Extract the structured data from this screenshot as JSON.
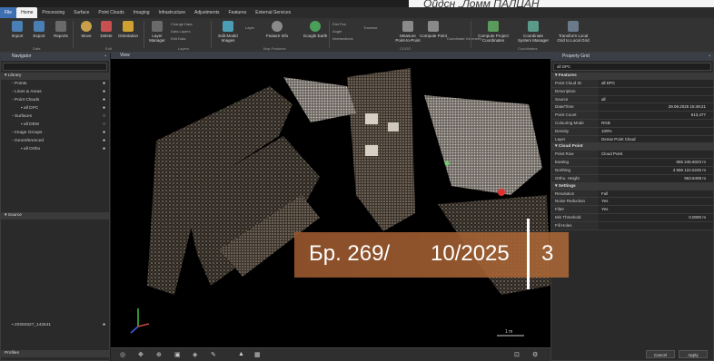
{
  "banner": {
    "text": "Ойдсн „Ломм ПАЛЦАН"
  },
  "tabs": [
    "File",
    "Home",
    "Processing",
    "Surface",
    "Point Clouds",
    "Imaging",
    "Infrastructure",
    "Adjustments",
    "Features",
    "External Services"
  ],
  "ribbon": {
    "buttons": [
      {
        "label": "Import",
        "color": "#4a7fb5"
      },
      {
        "label": "Export",
        "color": "#4a7fb5"
      },
      {
        "label": "Reports",
        "color": "#6a6a6a"
      },
      {
        "label": "Move",
        "color": "#c9a04a"
      },
      {
        "label": "Delete",
        "color": "#c85050"
      },
      {
        "label": "Orientation",
        "color": "#d0a030"
      },
      {
        "label": "Layer Manager",
        "color": "#6a6a6a"
      },
      {
        "label": "Edit Model Images",
        "color": "#4a9fb5"
      },
      {
        "label": "Feature Info",
        "color": "#8a8a8a"
      },
      {
        "label": "Google Earth",
        "color": "#4aa05a"
      },
      {
        "label": "Measure Point-to-Point",
        "color": "#8a8a8a"
      },
      {
        "label": "Compute Point",
        "color": "#8a8a8a"
      },
      {
        "label": "Compute Project Coordinates",
        "color": "#5a9a5a"
      },
      {
        "label": "Coordinate System Manager",
        "color": "#5a9a8a"
      },
      {
        "label": "Transform Local Grid to Local Grid",
        "color": "#6a7a8a"
      }
    ],
    "groups": [
      "Data",
      "Edit",
      "Layers",
      "Map Features",
      "COGO",
      "Coordinates"
    ],
    "small_items": [
      "Change Data",
      "Data Layers",
      "Edit Data",
      "Layer",
      "Dist Pos",
      "Angle",
      "Intersections",
      "Traverse",
      "Coordinate Geometry"
    ]
  },
  "navigator": {
    "title": "Navigator",
    "library_header": "Library",
    "items": [
      "Points",
      "Lines & Areas",
      "Point Clouds",
      "all DPC",
      "Surfaces",
      "all DEM",
      "Image Groups",
      "Georeferenced",
      "all Ortho"
    ],
    "source_header": "Source",
    "source_items": [
      "20250327_142541"
    ],
    "footer": "Profiles"
  },
  "viewport": {
    "title": "View",
    "scale": "1 m",
    "overlay": {
      "issue": "Бр. 269/",
      "date": "10/2025",
      "page": "3"
    }
  },
  "properties": {
    "title": "Property Grid",
    "selected": "all DPC",
    "sections": [
      {
        "name": "Features",
        "rows": [
          {
            "k": "Point Cloud ID",
            "v": "all DPC"
          },
          {
            "k": "Description",
            "v": ""
          },
          {
            "k": "Source",
            "v": "all"
          },
          {
            "k": "Date/Time",
            "v": "29.09.2025 15:49:21"
          },
          {
            "k": "Point Count",
            "v": "613,477"
          },
          {
            "k": "Colouring Mode",
            "v": "RGB"
          },
          {
            "k": "Density",
            "v": "100%"
          },
          {
            "k": "Layer",
            "v": "Dense Point Cloud"
          }
        ]
      },
      {
        "name": "Cloud Point",
        "rows": [
          {
            "k": "Point Row",
            "v": "Cloud Point"
          },
          {
            "k": "Easting",
            "v": "555 245.6023 m"
          },
          {
            "k": "Northing",
            "v": "4 556 124.5245 m"
          },
          {
            "k": "Ortho. Height",
            "v": "963.8408 m"
          }
        ]
      },
      {
        "name": "Settings",
        "rows": [
          {
            "k": "Resolution",
            "v": "Full"
          },
          {
            "k": "Noise Reduction",
            "v": "Yes"
          },
          {
            "k": "Filter",
            "v": "Yes"
          },
          {
            "k": "Min Threshold",
            "v": "0.0000 m"
          },
          {
            "k": "Fill Holes",
            "v": ""
          }
        ]
      }
    ],
    "buttons": [
      "Cancel",
      "Apply"
    ]
  }
}
